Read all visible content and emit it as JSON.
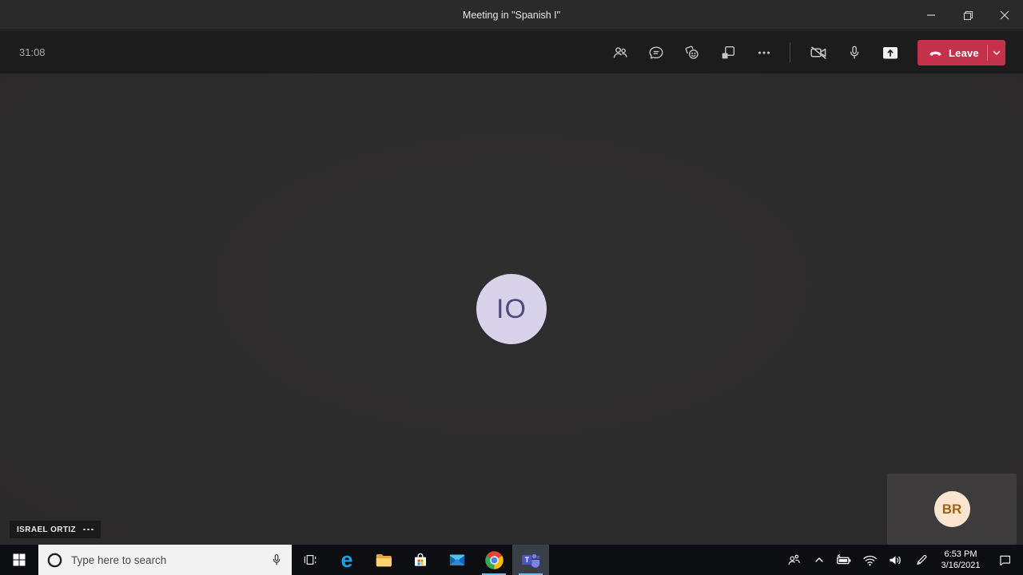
{
  "window": {
    "title": "Meeting in \"Spanish I\"",
    "controls": {
      "minimize": "minimize",
      "restore": "restore",
      "close": "close"
    }
  },
  "meeting": {
    "timer": "31:08",
    "toolbar": {
      "buttons": [
        "show-participants",
        "show-conversation",
        "reactions",
        "breakout-rooms",
        "more-actions",
        "camera-off",
        "microphone",
        "share-content"
      ],
      "leave_label": "Leave"
    },
    "stage": {
      "main_participant": {
        "initials": "IO",
        "name": "ISRAEL ORTIZ",
        "avatar_bg": "#D8D2EB",
        "avatar_text_color": "#4E4C7D"
      },
      "self_view": {
        "initials": "BR",
        "avatar_bg": "#FBE5CE",
        "avatar_text_color": "#9C6217"
      }
    }
  },
  "taskbar": {
    "search": {
      "placeholder": "Type here to search"
    },
    "apps": [
      "task-view",
      "edge",
      "file-explorer",
      "microsoft-store",
      "mail",
      "chrome",
      "teams"
    ],
    "running_apps": [
      "chrome",
      "teams"
    ],
    "active_app": "teams",
    "tray_icons": [
      "people",
      "hidden-icons-chevron",
      "battery-charging",
      "wifi",
      "volume",
      "windows-ink",
      "action-center"
    ],
    "clock": {
      "time": "6:53 PM",
      "date": "3/16/2021"
    }
  },
  "colors": {
    "titlebar_bg": "#2A2A2A",
    "meetingbar_bg": "#1D1C1C",
    "stage_bg": "#2D2C2C",
    "leave_red": "#C4314B",
    "taskbar_bg": "#0C0E11",
    "running_underline": "#76B9ED",
    "active_app_bg": "#3A3E47",
    "selfview_bg": "#3D3B3B"
  }
}
